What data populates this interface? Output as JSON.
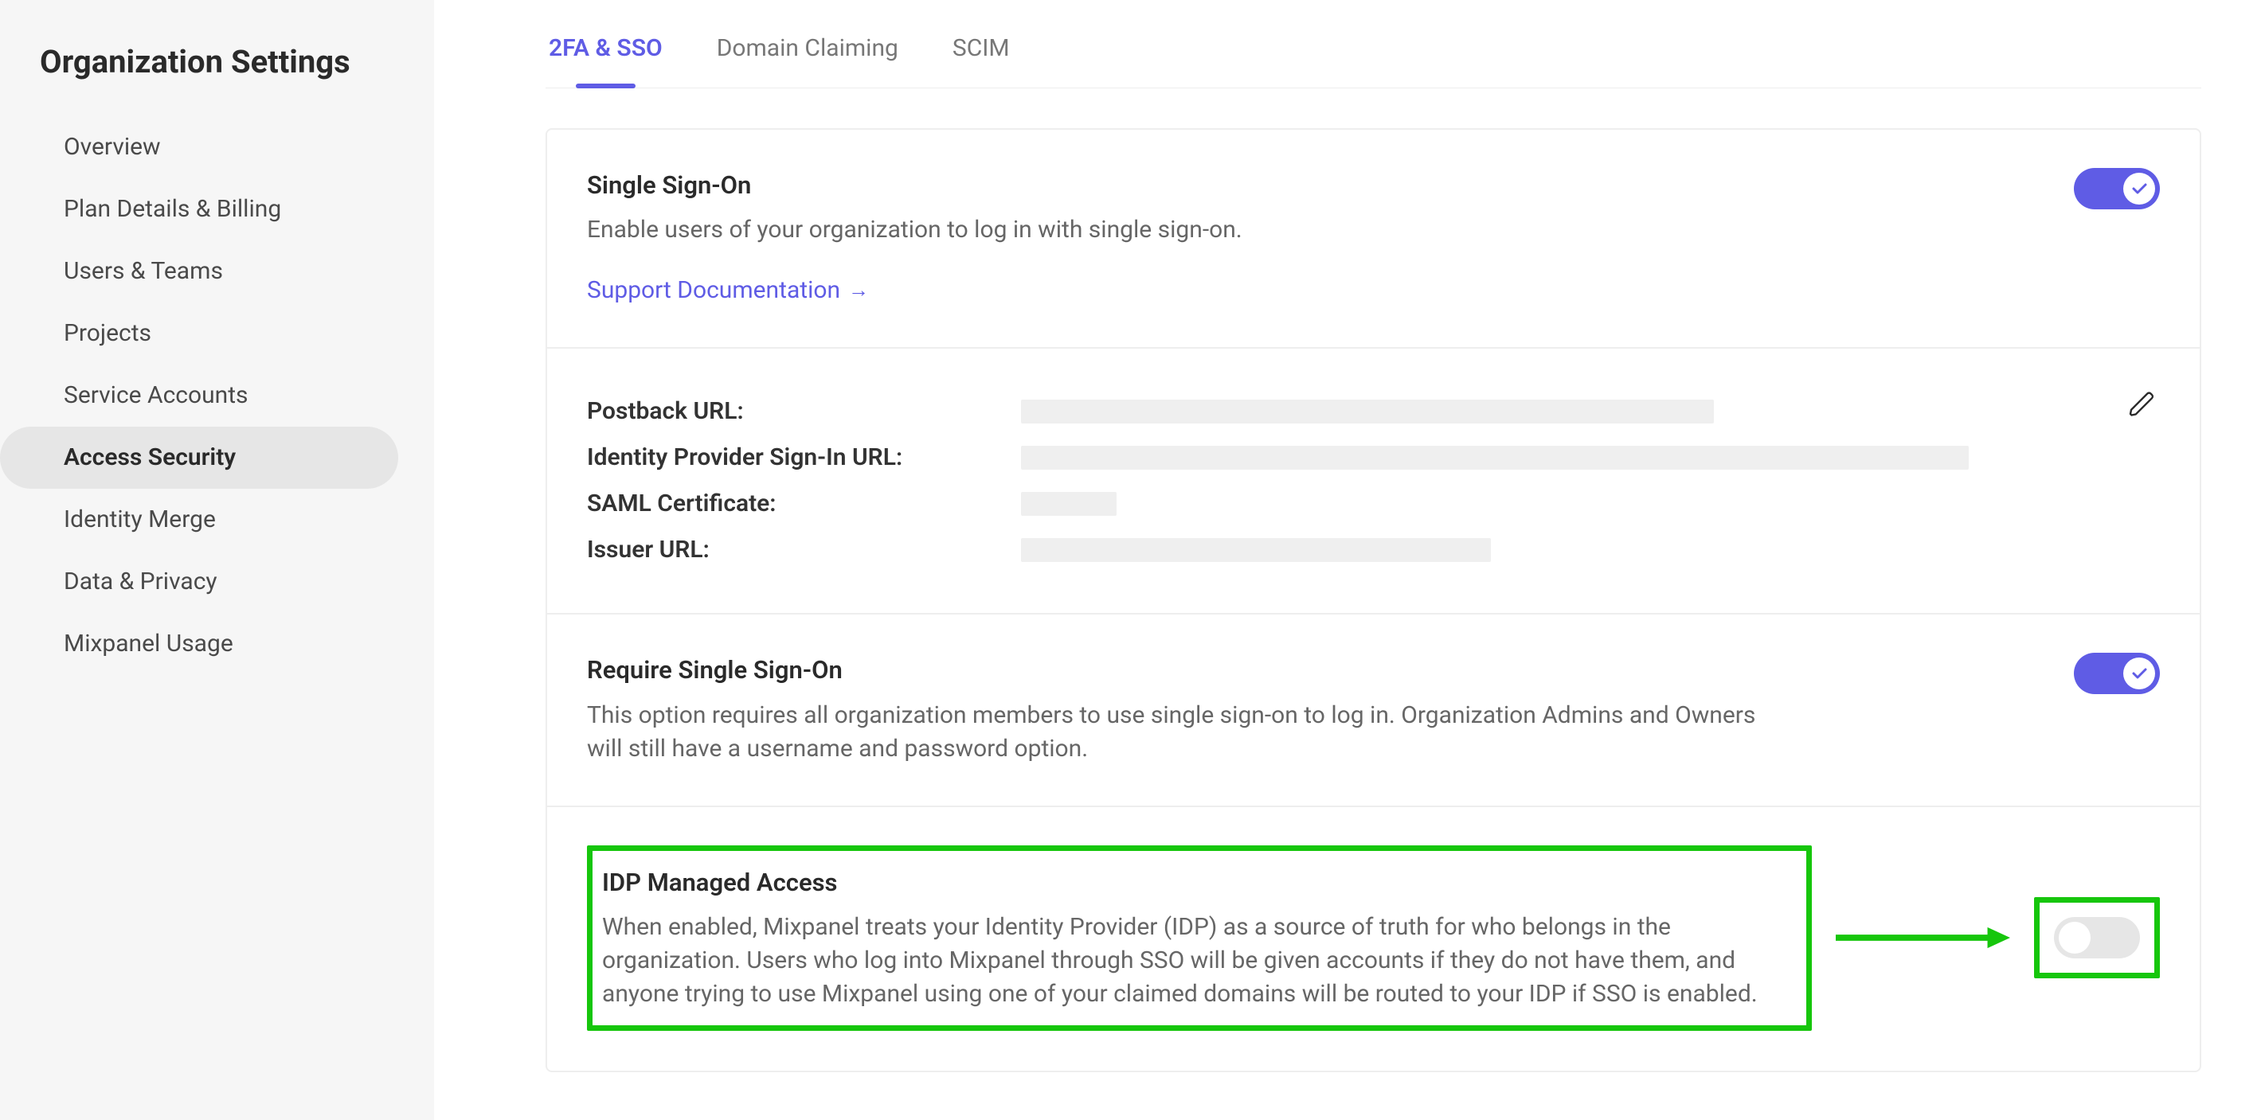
{
  "page_title": "Organization Settings",
  "sidebar": {
    "items": [
      {
        "label": "Overview"
      },
      {
        "label": "Plan Details & Billing"
      },
      {
        "label": "Users & Teams"
      },
      {
        "label": "Projects"
      },
      {
        "label": "Service Accounts"
      },
      {
        "label": "Access Security"
      },
      {
        "label": "Identity Merge"
      },
      {
        "label": "Data & Privacy"
      },
      {
        "label": "Mixpanel Usage"
      }
    ],
    "active_index": 5
  },
  "tabs": {
    "items": [
      {
        "label": "2FA & SSO"
      },
      {
        "label": "Domain Claiming"
      },
      {
        "label": "SCIM"
      }
    ],
    "active_index": 0
  },
  "sso": {
    "title": "Single Sign-On",
    "description": "Enable users of your organization to log in with single sign-on.",
    "support_link": "Support Documentation",
    "enabled": true
  },
  "fields": {
    "postback_url": {
      "label": "Postback URL:"
    },
    "idp_signin_url": {
      "label": "Identity Provider Sign-In URL:"
    },
    "saml_certificate": {
      "label": "SAML Certificate:"
    },
    "issuer_url": {
      "label": "Issuer URL:"
    }
  },
  "require_sso": {
    "title": "Require Single Sign-On",
    "description": "This option requires all organization members to use single sign-on to log in. Organization Admins and Owners will still have a username and password option.",
    "enabled": true
  },
  "idp": {
    "title": "IDP Managed Access",
    "description": "When enabled, Mixpanel treats your Identity Provider (IDP) as a source of truth for who belongs in the organization. Users who log into Mixpanel through SSO will be given accounts if they do not have them, and anyone trying to use Mixpanel using one of your claimed domains will be routed to your IDP if SSO is enabled.",
    "enabled": false
  }
}
